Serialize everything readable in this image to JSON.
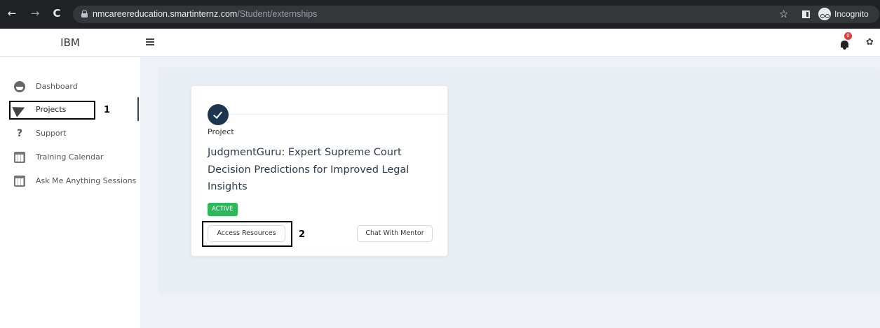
{
  "browser": {
    "url_host": "nmcareereducation.smartinternz.com",
    "url_path": "/Student/externships",
    "back_glyph": "←",
    "forward_glyph": "→",
    "reload_glyph": "C",
    "star_glyph": "☆",
    "incognito_label": "Incognito"
  },
  "header": {
    "brand": "IBM",
    "notification_count": "0",
    "gear_glyph": "✿"
  },
  "sidebar": {
    "items": [
      {
        "label": "Dashboard",
        "icon": "dashboard-icon"
      },
      {
        "label": "Projects",
        "icon": "paper-plane-icon"
      },
      {
        "label": "Support",
        "icon": "question-icon"
      },
      {
        "label": "Training Calendar",
        "icon": "calendar-icon"
      },
      {
        "label": "Ask Me Anything Sessions",
        "icon": "calendar-icon"
      }
    ],
    "support_glyph": "?"
  },
  "card": {
    "type": "Project",
    "title": "JudgmentGuru: Expert Supreme Court Decision Predictions for Improved Legal Insights",
    "status": "ACTIVE",
    "access_button": "Access Resources",
    "mentor_button": "Chat With Mentor"
  },
  "annotations": {
    "marker_1": "1",
    "marker_2": "2"
  },
  "colors": {
    "badge_green": "#2eb85c",
    "check_navy": "#1e3550",
    "notif_red": "#e53935",
    "browser_dark": "#202124"
  }
}
